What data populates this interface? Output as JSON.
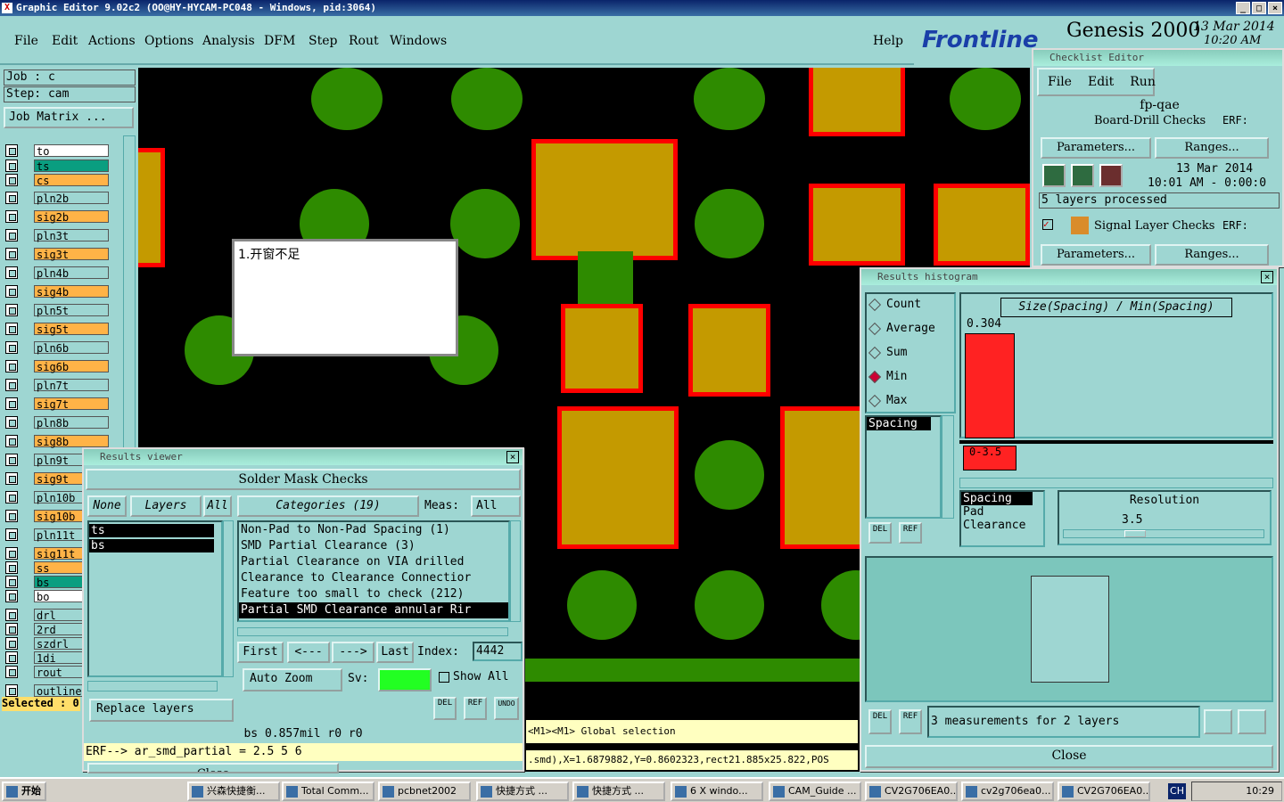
{
  "window": {
    "title": "Graphic Editor 9.02c2 (OO@HY-HYCAM-PC048 - Windows, pid:3064)"
  },
  "menu": {
    "items": [
      "File",
      "Edit",
      "Actions",
      "Options",
      "Analysis",
      "DFM",
      "Step",
      "Rout",
      "Windows"
    ],
    "help": "Help"
  },
  "brand": {
    "logo": "Frontline",
    "product": "Genesis 2000",
    "date": "13 Mar 2014",
    "time": "10:20 AM"
  },
  "job": {
    "job_label": "Job : c",
    "step_label": "Step: cam",
    "matrix_btn": "Job Matrix ..."
  },
  "layers": [
    "to",
    "ts",
    "cs",
    "pln2b",
    "sig2b",
    "pln3t",
    "sig3t",
    "pln4b",
    "sig4b",
    "pln5t",
    "sig5t",
    "pln6b",
    "sig6b",
    "pln7t",
    "sig7t",
    "pln8b",
    "sig8b",
    "pln9t",
    "sig9t",
    "pln10b",
    "sig10b",
    "pln11t",
    "sig11t",
    "ss",
    "bs",
    "bo",
    "drl",
    "2rd",
    "szdrl",
    "1di",
    "rout",
    "outline"
  ],
  "selected_label": "Selected : 0",
  "note": {
    "text": "1.开窗不足"
  },
  "checklist": {
    "title": "Checklist Editor",
    "menus": [
      "File",
      "Edit",
      "Run"
    ],
    "name": "fp-qae",
    "row1_name": "Board-Drill Checks",
    "erf": "ERF:",
    "params_btn": "Parameters...",
    "ranges_btn": "Ranges...",
    "date": "13 Mar 2014",
    "time": "10:01 AM - 0:00:0",
    "processed": "5 layers processed",
    "row2_name": "Signal Layer Checks"
  },
  "histogram": {
    "title": "Results histogram",
    "options": [
      "Count",
      "Average",
      "Sum",
      "Min",
      "Max"
    ],
    "selected": "Min",
    "header": "Size(Spacing) / Min(Spacing)",
    "value": "0.304",
    "bar_label": "0-3.5",
    "list1": [
      "Spacing"
    ],
    "list2": [
      "Spacing",
      "Pad",
      "Clearance"
    ],
    "res_label": "Resolution",
    "res_value": "3.5",
    "status": "3 measurements for 2 layers",
    "close": "Close",
    "del": "DEL",
    "ref": "REF"
  },
  "results": {
    "title": "Results viewer",
    "header": "Solder Mask Checks",
    "none": "None",
    "layers": "Layers",
    "all": "All",
    "categories": "Categories (19)",
    "meas_label": "Meas:",
    "meas_value": "All",
    "layer_list": [
      "ts",
      "bs"
    ],
    "cat_list": [
      "Non-Pad to Non-Pad Spacing (1)",
      "SMD Partial Clearance (3)",
      "Partial Clearance on VIA drilled",
      "Clearance to Clearance Connectior",
      "Feature too small to check (212)",
      "Partial SMD Clearance annular Rir"
    ],
    "first": "First",
    "prev": "<---",
    "next": "--->",
    "last": "Last",
    "index_label": "Index:",
    "index_value": "4442",
    "auto_zoom": "Auto Zoom",
    "sv_label": "Sv:",
    "show_all": "Show All",
    "replace": "Replace layers",
    "info": "bs 0.857mil  r0  r0",
    "erf": "ERF--> ar_smd_partial = 2.5 5 6",
    "close": "Close",
    "del": "DEL",
    "ref": "REF",
    "undo": "UNDO"
  },
  "statusbar": {
    "line1": "<M1><M1> Global selection",
    "line2": ".smd),X=1.6879882,Y=0.8602323,rect21.885x25.822,POS"
  },
  "taskbar": {
    "start": "开始",
    "tasks": [
      "兴森快捷衡...",
      "Total Comm...",
      "pcbnet2002",
      "快捷方式 ...",
      "快捷方式 ...",
      "6 X windo...",
      "CAM_Guide ...",
      "CV2G706EA0...",
      "cv2g706ea0...",
      "CV2G706EA0..."
    ],
    "lang": "CH",
    "clock": "10:29"
  }
}
